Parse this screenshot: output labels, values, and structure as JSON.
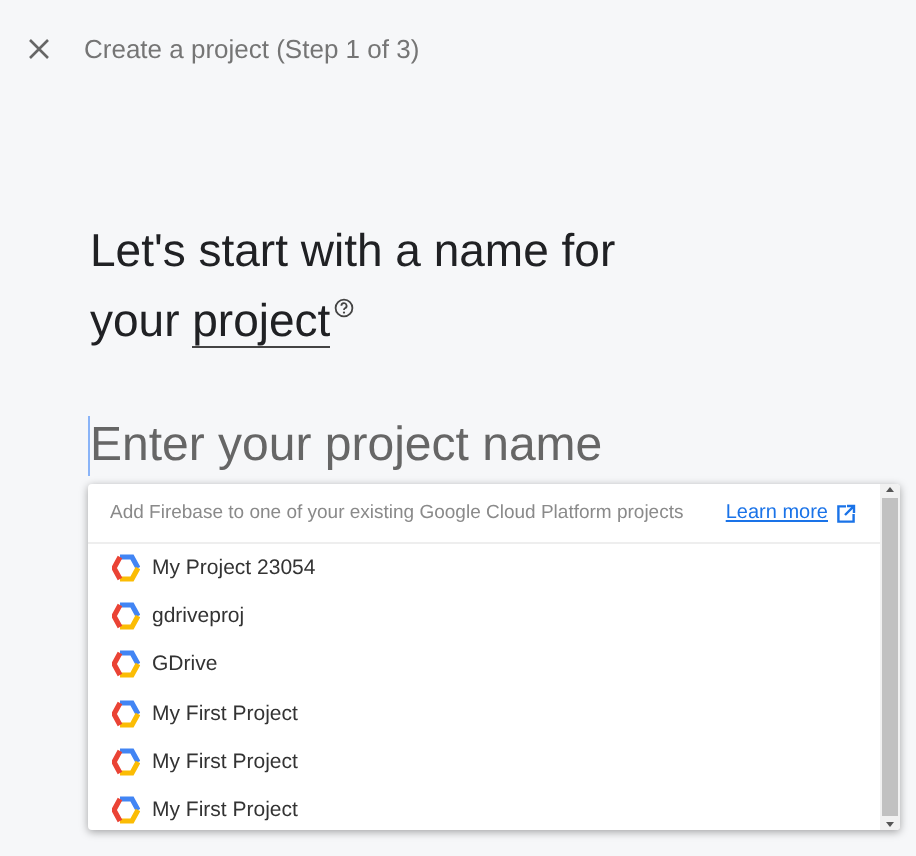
{
  "header": {
    "title": "Create a project (Step 1 of 3)"
  },
  "heading": {
    "text": "Let's start with a name for your ",
    "term": "project"
  },
  "name_field": {
    "placeholder": "Enter your project name"
  },
  "dropdown": {
    "hint": "Add Firebase to one of your existing Google Cloud Platform projects",
    "link": "Learn more",
    "projects": [
      {
        "name": "My Project 23054"
      },
      {
        "name": "gdriveproj"
      },
      {
        "name": "GDrive"
      },
      {
        "name": "My First Project"
      },
      {
        "name": "My First Project"
      },
      {
        "name": "My First Project"
      }
    ]
  }
}
